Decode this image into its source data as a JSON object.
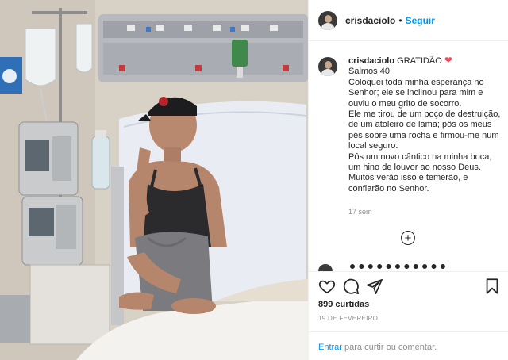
{
  "post": {
    "username": "crisdaciolo",
    "separator": "•",
    "follow_label": "Seguir",
    "caption_title": "GRATIDÃO",
    "caption_body": "Salmos 40\nColoquei toda minha esperança no Senhor; ele se inclinou para mim e ouviu o meu grito de socorro.\nEle me tirou de um poço de destruição, de um atoleiro de lama; pôs os meus pés sobre uma rocha e firmou-me num local seguro.\nPôs um novo cântico na minha boca, um hino de louvor ao nosso Deus. Muitos verão isso e temerão, e confiarão no Senhor.",
    "time_ago": "17 sem",
    "likes": "899 curtidas",
    "date": "19 DE FEVEREIRO",
    "login_link": "Entrar",
    "login_text": " para curtir ou comentar."
  },
  "icons": {
    "caption_emoji": "heart",
    "more_comments": "plus-circle",
    "like": "heart-outline",
    "comment": "speech-bubble",
    "share": "paper-plane",
    "save": "bookmark"
  },
  "colors": {
    "link_blue": "#0095f6",
    "heart_red": "#ed4956",
    "text_dark": "#262626",
    "text_muted": "#8e8e8e"
  }
}
